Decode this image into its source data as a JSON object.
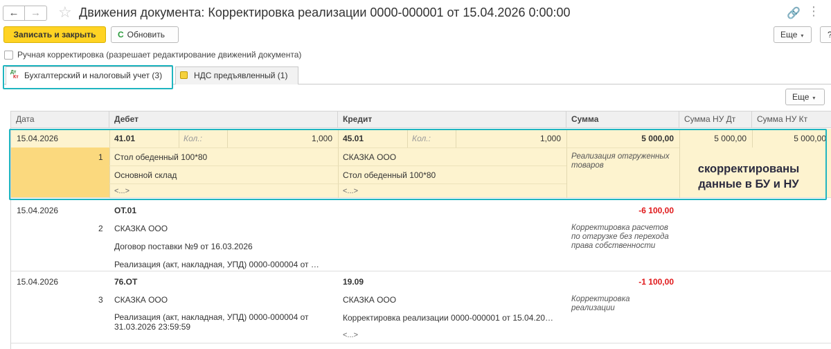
{
  "window": {
    "title": "Движения документа: Корректировка реализации 0000-000001 от 15.04.2026 0:00:00",
    "back": "←",
    "forward": "→",
    "star": "☆",
    "link": "🔗",
    "more": "⋮"
  },
  "toolbar": {
    "save_close": "Записать и закрыть",
    "refresh": "Обновить",
    "refresh_icon": "C",
    "more": "Еще",
    "help": "?"
  },
  "manual": {
    "label": "Ручная корректировка (разрешает редактирование движений документа)",
    "checked": false
  },
  "tabs": [
    {
      "label": "Бухгалтерский и налоговый учет (3)",
      "icon": "dt-kt-icon",
      "icon_d": "Дт",
      "icon_k": "Кт",
      "active": true
    },
    {
      "label": "НДС предъявленный (1)",
      "icon": "register-icon",
      "active": false
    }
  ],
  "grid": {
    "more": "Еще",
    "columns": [
      "Дата",
      "Дебет",
      "Кредит",
      "Сумма",
      "Сумма НУ Дт",
      "Сумма НУ Кт"
    ],
    "kol_label": "Кол.:",
    "rows": [
      {
        "date": "15.04.2026",
        "num": "1",
        "debit": {
          "account": "41.01",
          "qty": "1,000",
          "lines": [
            "Стол обеденный 100*80",
            "Основной склад",
            "<...>"
          ]
        },
        "credit": {
          "account": "45.01",
          "qty": "1,000",
          "lines": [
            "СКАЗКА ООО",
            "Стол обеденный 100*80",
            "<...>"
          ]
        },
        "sum": "5 000,00",
        "content": "Реализация отгруженных товаров",
        "nu_dt": "5 000,00",
        "nu_kt": "5 000,00"
      },
      {
        "date": "15.04.2026",
        "num": "2",
        "debit": {
          "account": "ОТ.01",
          "lines": [
            "СКАЗКА ООО",
            "Договор поставки №9 от 16.03.2026",
            "Реализация (акт, накладная, УПД) 0000-000004 от …"
          ]
        },
        "sum": "-6 100,00",
        "content": "Корректировка расчетов по отгрузке без перехода права собственности"
      },
      {
        "date": "15.04.2026",
        "num": "3",
        "debit": {
          "account": "76.ОТ",
          "lines": [
            "СКАЗКА ООО",
            "Реализация (акт, накладная, УПД) 0000-000004 от 31.03.2026 23:59:59"
          ]
        },
        "credit": {
          "account": "19.09",
          "lines": [
            "СКАЗКА ООО",
            "Корректировка реализации 0000-000001 от 15.04.20…",
            "<...>"
          ]
        },
        "sum": "-1 100,00",
        "content": "Корректировка реализации"
      }
    ]
  },
  "annotation": "скорректированы данные в БУ и НУ",
  "colors": {
    "accent": "#ffd323",
    "highlight": "#1fb5c0",
    "negative": "#e0191b",
    "selected_row": "#fdf3cf"
  }
}
